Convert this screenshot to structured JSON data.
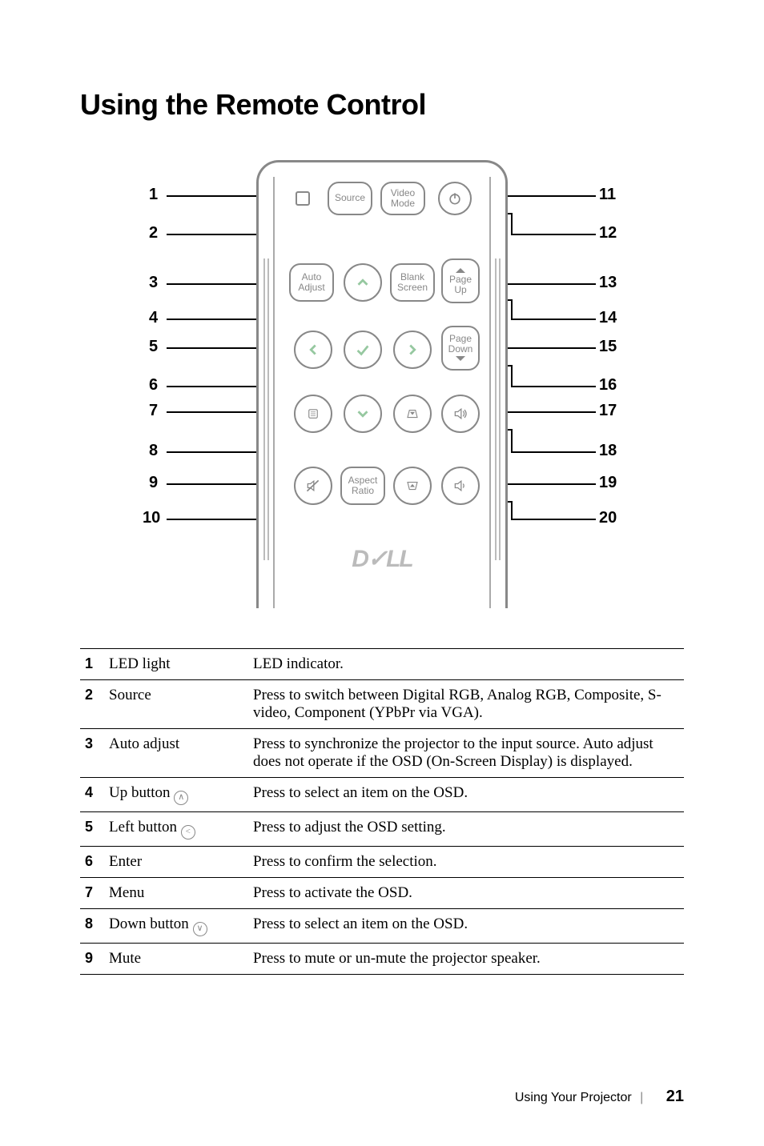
{
  "title": "Using the Remote Control",
  "remote_labels": {
    "source": "Source",
    "video_mode_1": "Video",
    "video_mode_2": "Mode",
    "auto_adjust_1": "Auto",
    "auto_adjust_2": "Adjust",
    "blank_screen_1": "Blank",
    "blank_screen_2": "Screen",
    "page_up_1": "Page",
    "page_up_2": "Up",
    "page_down_1": "Page",
    "page_down_2": "Down",
    "aspect_ratio_1": "Aspect",
    "aspect_ratio_2": "Ratio",
    "brand": "D✓LL"
  },
  "callouts": {
    "n1": "1",
    "n2": "2",
    "n3": "3",
    "n4": "4",
    "n5": "5",
    "n6": "6",
    "n7": "7",
    "n8": "8",
    "n9": "9",
    "n10": "10",
    "n11": "11",
    "n12": "12",
    "n13": "13",
    "n14": "14",
    "n15": "15",
    "n16": "16",
    "n17": "17",
    "n18": "18",
    "n19": "19",
    "n20": "20"
  },
  "rows": [
    {
      "n": "1",
      "name": "LED light",
      "desc": "LED indicator."
    },
    {
      "n": "2",
      "name": "Source",
      "desc": "Press to switch between Digital RGB, Analog RGB, Composite, S-video, Component (YPbPr via VGA)."
    },
    {
      "n": "3",
      "name": "Auto adjust",
      "desc": "Press to synchronize the projector to the input source. Auto adjust does not operate if the OSD (On-Screen Display) is displayed."
    },
    {
      "n": "4",
      "name": "Up button ",
      "sym": "∧",
      "desc": "Press to select an item on the OSD."
    },
    {
      "n": "5",
      "name": "Left button ",
      "sym": "<",
      "desc": "Press to adjust the OSD setting."
    },
    {
      "n": "6",
      "name": "Enter",
      "desc": "Press to confirm the selection."
    },
    {
      "n": "7",
      "name": "Menu",
      "desc": "Press to activate the OSD."
    },
    {
      "n": "8",
      "name": "Down button ",
      "sym": "∨",
      "desc": "Press to select an item on the OSD."
    },
    {
      "n": "9",
      "name": "Mute",
      "desc": "Press to mute or un-mute the projector speaker."
    }
  ],
  "footer": {
    "section": "Using Your Projector",
    "page": "21"
  }
}
